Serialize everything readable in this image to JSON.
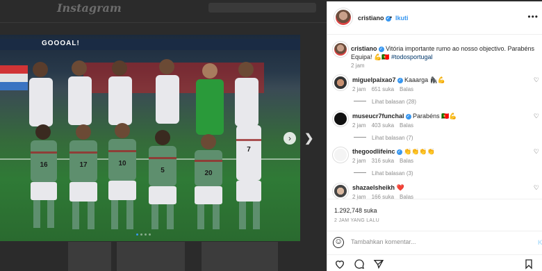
{
  "background": {
    "logo": "Instagram"
  },
  "photo": {
    "banner": "GOOOAL!",
    "jersey_numbers": [
      "16",
      "17",
      "10",
      "5",
      "20",
      "7"
    ]
  },
  "post": {
    "author": {
      "username": "cristiano",
      "verified": true,
      "follow_label": "Ikuti",
      "separator": "•"
    },
    "caption": {
      "username": "cristiano",
      "text": "Vitória importante rumo ao nosso objectivo. Parabéns Equipa! 💪🇵🇹",
      "hashtag": "#todosportugal",
      "time": "2 jam"
    },
    "comments": [
      {
        "username": "miguelpaixao7",
        "verified": true,
        "text": "Kaaarga 🦍💪",
        "time": "2 jam",
        "likes": "651 suka",
        "reply": "Balas",
        "view_replies": "Lihat balasan (28)"
      },
      {
        "username": "museucr7funchal",
        "verified": true,
        "text": "Parabéns 🇵🇹💪",
        "time": "2 jam",
        "likes": "403 suka",
        "reply": "Balas",
        "view_replies": "Lihat balasan (7)"
      },
      {
        "username": "thegoodlifeinc",
        "verified": true,
        "text": "👏👏👏👏",
        "time": "2 jam",
        "likes": "316 suka",
        "reply": "Balas",
        "view_replies": "Lihat balasan (3)"
      },
      {
        "username": "shazaelsheikh",
        "verified": false,
        "text": "❤️",
        "time": "2 jam",
        "likes": "166 suka",
        "reply": "Balas",
        "view_replies": ""
      }
    ],
    "likes": "1.292,748 suka",
    "posted": "2 JAM YANG LALU",
    "add_comment_placeholder": "Tambahkan komentar...",
    "post_label": "Ki"
  },
  "icons": {
    "heart": "♡",
    "comment": "◯",
    "share": "➤",
    "save": "▯",
    "more": "•••",
    "next": "›",
    "nav_next": "❯"
  }
}
